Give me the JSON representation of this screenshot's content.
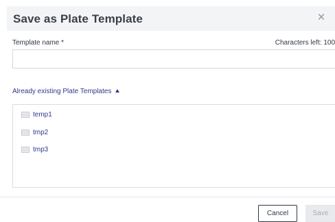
{
  "dialog": {
    "title": "Save as Plate Template",
    "close_icon": "×"
  },
  "form": {
    "name_label": "Template name *",
    "chars_left": "Characters left: 100",
    "name_value": "",
    "name_placeholder": ""
  },
  "existing": {
    "toggle_label": "Already existing Plate Templates",
    "expanded": true,
    "items": [
      {
        "label": "temp1",
        "icon": "plate-template-icon"
      },
      {
        "label": "tmp2",
        "icon": "plate-template-icon"
      },
      {
        "label": "tmp3",
        "icon": "plate-template-icon"
      }
    ]
  },
  "footer": {
    "cancel_label": "Cancel",
    "save_label": "Save",
    "save_enabled": false
  },
  "colors": {
    "header_bg": "#f3f4f6",
    "link": "#2d3a8c",
    "text": "#2f3745",
    "disabled_bg": "#e8eaed",
    "disabled_text": "#a8adb5"
  }
}
